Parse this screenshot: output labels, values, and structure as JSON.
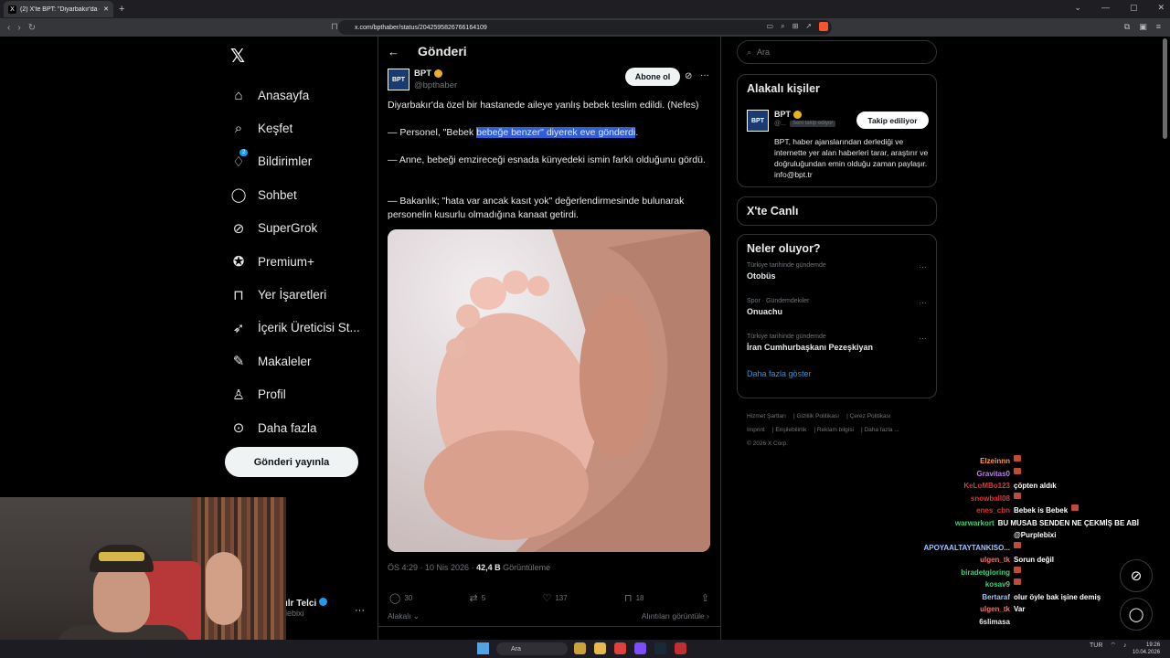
{
  "browser": {
    "tab_title": "(2) X'te BPT: \"Diyarbakır'da özel",
    "url": "x.com/bpthaber/status/2042595826766164109"
  },
  "sidebar": {
    "items": [
      {
        "label": "Anasayfa",
        "icon": "home-icon"
      },
      {
        "label": "Keşfet",
        "icon": "search-icon"
      },
      {
        "label": "Bildirimler",
        "icon": "bell-icon",
        "badge": "2"
      },
      {
        "label": "Sohbet",
        "icon": "chat-icon"
      },
      {
        "label": "SuperGrok",
        "icon": "grok-icon"
      },
      {
        "label": "Premium+",
        "icon": "premium-icon"
      },
      {
        "label": "Yer İşaretleri",
        "icon": "bookmark-icon"
      },
      {
        "label": "İçerik Üreticisi St...",
        "icon": "rocket-icon"
      },
      {
        "label": "Makaleler",
        "icon": "article-icon"
      },
      {
        "label": "Profil",
        "icon": "person-icon"
      },
      {
        "label": "Daha fazla",
        "icon": "more-circle-icon"
      }
    ],
    "post_button": "Gönderi yayınla",
    "account_name": "ılr Telci",
    "account_handle": "lebixi"
  },
  "post": {
    "header": "Gönderi",
    "author_name": "BPT",
    "author_handle": "@bpthaber",
    "avatar_text": "BPT",
    "subscribe_button": "Abone ol",
    "text_line1": "Diyarbakır'da özel bir hastanede aileye yanlış bebek teslim edildi. (Nefes)",
    "text_line2_a": "— Personel, \"Bebek ",
    "text_line2_hl": "bebeğe benzer\" diyerek eve gönderdi",
    "text_line2_b": ".",
    "text_line3": "— Anne, bebeği emzireceği esnada künyedeki ismin farklı olduğunu gördü.",
    "text_line4": "— Bakanlık; \"hata var ancak kasıt yok\" değerlendirmesinde bulunarak personelin kusurlu olmadığına kanaat getirdi.",
    "time": "ÖS 4:29 · 10 Nis 2026 · ",
    "views": "42,4 B",
    "views_label": " Görüntüleme",
    "replies": "30",
    "reposts": "5",
    "likes": "137",
    "bookmarks": "18",
    "sort": "Alakalı",
    "quotes_link": "Alıntıları görüntüle"
  },
  "right": {
    "search_placeholder": "Ara",
    "related_title": "Alakalı kişiler",
    "related_name": "BPT",
    "related_handle": "@...",
    "follows_you": "Seni takip ediyor",
    "following_button": "Takip ediliyor",
    "related_bio": "BPT, haber ajanslarından derlediği ve internette yer alan haberleri tarar, araştırır ve doğruluğundan emin olduğu zaman paylaşır. info@bpt.tr",
    "live_title": "X'te Canlı",
    "trends_title": "Neler oluyor?",
    "trends": [
      {
        "context": "Türkiye tarihinde gündemde",
        "topic": "Otobüs"
      },
      {
        "context": "Spor · Gündemdekiler",
        "topic": "Onuachu"
      },
      {
        "context": "Türkiye tarihinde gündemde",
        "topic": "İran Cumhurbaşkanı Pezeşkiyan"
      }
    ],
    "show_more": "Daha fazla göster",
    "footer": [
      "Hizmet Şartları",
      "Gizlilik Politikası",
      "Çerez Politikası",
      "Imprint",
      "Erişilebilirlik",
      "Reklam bilgisi",
      "Daha fazla ...",
      "© 2026 X Corp."
    ]
  },
  "chat": [
    {
      "user": "Elzeinnn",
      "msg": "",
      "color": "#ff9a3c"
    },
    {
      "user": "Gravitas0",
      "msg": "",
      "color": "#c07af0"
    },
    {
      "user": "KeLoMBo123",
      "msg": "çöpten aldık",
      "color": "#d93838"
    },
    {
      "user": "snowball08",
      "msg": "",
      "color": "#d93838"
    },
    {
      "user": "enes_cbn",
      "msg": "Bebek is Bebek",
      "color": "#d93838"
    },
    {
      "user": "warwarkort",
      "msg": "BU MUSAB SENDEN NE ÇEKMİŞ BE ABİ",
      "color": "#3ed27a"
    },
    {
      "user": "",
      "msg": "@Purplebixi",
      "color": "#fff"
    },
    {
      "user": "APOYAALTAYTANKISO...",
      "msg": "",
      "color": "#9fc3ff"
    },
    {
      "user": "ulgen_tk",
      "msg": "Sorun değil",
      "color": "#ff6b6b"
    },
    {
      "user": "biradetgloring",
      "msg": "",
      "color": "#3ed27a"
    },
    {
      "user": "kosav9",
      "msg": "",
      "color": "#3ed27a"
    },
    {
      "user": "Bertaraf",
      "msg": "olur öyle bak işine demiş",
      "color": "#9fc3ff"
    },
    {
      "user": "ulgen_tk",
      "msg": "Var",
      "color": "#ff6b6b"
    },
    {
      "user": "6slimasa",
      "msg": "",
      "color": "#fff"
    }
  ],
  "taskbar": {
    "search_placeholder": "Ara",
    "lang": "TUR",
    "time": "19:26",
    "date": "10.04.2026"
  }
}
